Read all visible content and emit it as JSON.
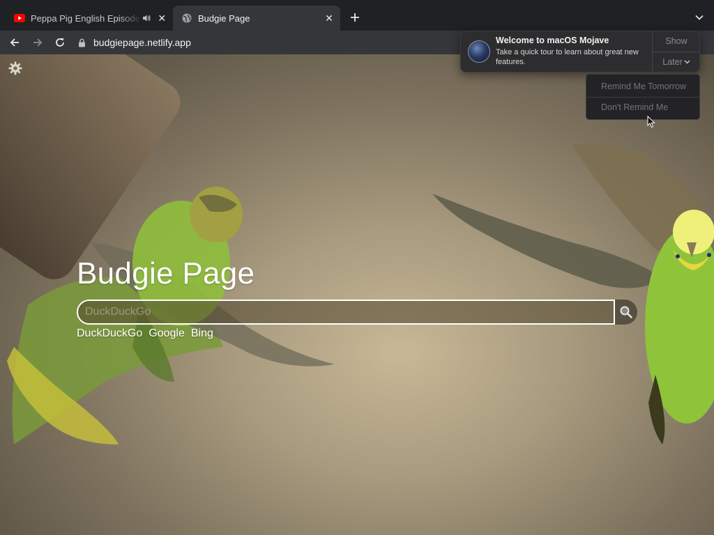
{
  "browser": {
    "tabs": [
      {
        "title": "Peppa Pig English Episodes",
        "favicon": "youtube-icon",
        "audio": true,
        "active": false
      },
      {
        "title": "Budgie Page",
        "favicon": "globe-icon",
        "active": true
      }
    ],
    "address_bar": {
      "url": "budgiepage.netlify.app",
      "secure": true
    }
  },
  "page": {
    "title": "Budgie Page",
    "search": {
      "placeholder": "DuckDuckGo",
      "value": ""
    },
    "engines": [
      "DuckDuckGo",
      "Google",
      "Bing"
    ]
  },
  "notification": {
    "title": "Welcome to macOS Mojave",
    "body": "Take a quick tour to learn about great new features.",
    "show_label": "Show",
    "later_label": "Later",
    "later_menu": [
      "Remind Me Tomorrow",
      "Don't Remind Me"
    ]
  },
  "colors": {
    "tabstrip_bg": "#202124",
    "toolbar_bg": "#35363a",
    "youtube_red": "#ff0000"
  }
}
